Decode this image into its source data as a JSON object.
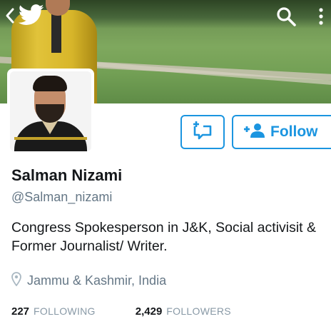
{
  "profile": {
    "name": "Salman Nizami",
    "handle": "@Salman_nizami",
    "bio": "Congress Spokesperson in J&K, Social activisit & Former Journalist/ Writer.",
    "location": "Jammu & Kashmir, India"
  },
  "stats": {
    "following_count": "227",
    "following_label": "FOLLOWING",
    "followers_count": "2,429",
    "followers_label": "FOLLOWERS"
  },
  "actions": {
    "follow_label": "Follow"
  },
  "icons": {
    "back": "back-chevron-icon",
    "logo": "twitter-bird-icon",
    "search": "search-icon",
    "more": "more-vertical-icon",
    "message": "direct-message-icon",
    "follow": "add-user-icon",
    "location": "location-pin-icon"
  },
  "colors": {
    "accent": "#1b95e0",
    "text_primary": "#14171a",
    "text_secondary": "#657786"
  }
}
